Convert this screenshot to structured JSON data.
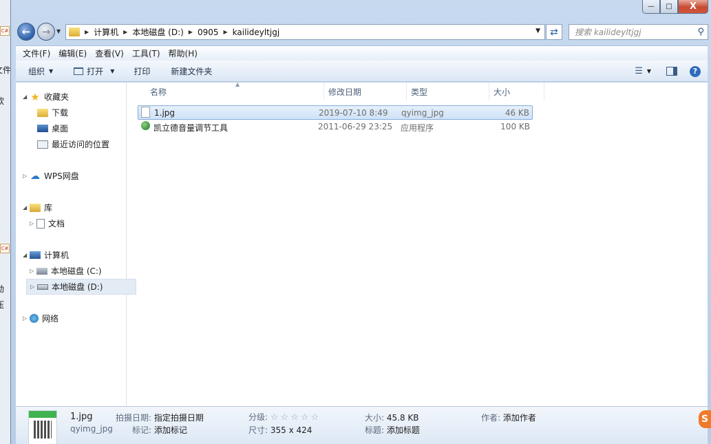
{
  "background": {
    "texts": [
      "文件",
      "软",
      "动",
      "压"
    ],
    "badge": "C#"
  },
  "window": {
    "controls": {
      "minimize": "—",
      "maximize": "□",
      "close": "X"
    }
  },
  "address": {
    "crumbs": [
      "计算机",
      "本地磁盘 (D:)",
      "0905",
      "kailideyltjgj"
    ],
    "search_placeholder": "搜索 kailideyltjgj"
  },
  "menu": [
    "文件(F)",
    "编辑(E)",
    "查看(V)",
    "工具(T)",
    "帮助(H)"
  ],
  "toolbar": {
    "organize": "组织",
    "open": "打开",
    "print": "打印",
    "new_folder": "新建文件夹"
  },
  "nav": {
    "favorites": "收藏夹",
    "downloads": "下载",
    "desktop": "桌面",
    "recent": "最近访问的位置",
    "wps": "WPS网盘",
    "libraries": "库",
    "documents": "文档",
    "computer": "计算机",
    "drive_c": "本地磁盘 (C:)",
    "drive_d": "本地磁盘 (D:)",
    "network": "网络"
  },
  "columns": {
    "name": "名称",
    "modified": "修改日期",
    "type": "类型",
    "size": "大小"
  },
  "files": [
    {
      "name": "1.jpg",
      "modified": "2019-07-10 8:49",
      "type": "qyimg_jpg",
      "size": "46 KB",
      "icon": "file-icon"
    },
    {
      "name": "凯立德音量调节工具",
      "modified": "2011-06-29 23:25",
      "type": "应用程序",
      "size": "100 KB",
      "icon": "app-icon"
    }
  ],
  "details": {
    "filename": "1.jpg",
    "filetype": "qyimg_jpg",
    "date_label": "拍摄日期:",
    "date_value": "指定拍摄日期",
    "tag_label": "标记:",
    "tag_value": "添加标记",
    "rating_label": "分级:",
    "rating_stars": "☆☆☆☆☆",
    "dims_label": "尺寸:",
    "dims_value": "355 x 424",
    "size_label": "大小:",
    "size_value": "45.8 KB",
    "title_label": "标题:",
    "title_value": "添加标题",
    "author_label": "作者:",
    "author_value": "添加作者"
  }
}
